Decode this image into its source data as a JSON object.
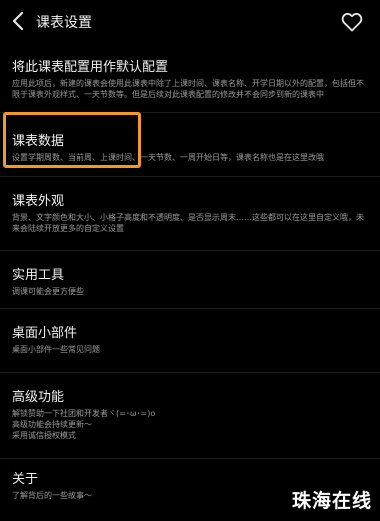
{
  "header": {
    "title": "课表设置"
  },
  "sections": [
    {
      "heading": "将此课表配置用作默认配置",
      "desc": "应用此项后，新建的课表会使用此课表中除了上课时间、课表名称、开学日期以外的配置，包括但不限于课表外观样式、一天节数等。但是后续对此课表配置的修改并不会同步到新的课表中"
    },
    {
      "heading": "课表数据",
      "desc": "设置学期周数、当前周、上课时间、一天节数、一周开始日等，课表名称也是在这里改哦"
    },
    {
      "heading": "课表外观",
      "desc": "背景、文字颜色和大小、小格子高度和不透明度、是否显示周末……这些都可以在这里自定义哦，未来会陆续开放更多的自定义设置"
    },
    {
      "heading": "实用工具",
      "desc": "调课可能会更方便些"
    },
    {
      "heading": "桌面小部件",
      "desc": "桌面小部件一些常见问题"
    },
    {
      "heading": "高级功能",
      "desc": "解锁赞助一下社团和开发者ヾ(=･ω･=)o\n高级功能会持续更新～\n采用诚信授权模式"
    },
    {
      "heading": "关于",
      "desc": "了解背后的一些故事～"
    }
  ],
  "watermark": "珠海在线",
  "colors": {
    "background": "#000000",
    "highlight": "#f39a22",
    "text_primary": "#f0f0f0",
    "text_secondary": "#9a9a9a"
  },
  "icons": {
    "back": "chevron-left-icon",
    "favorite": "heart-outline-icon"
  }
}
